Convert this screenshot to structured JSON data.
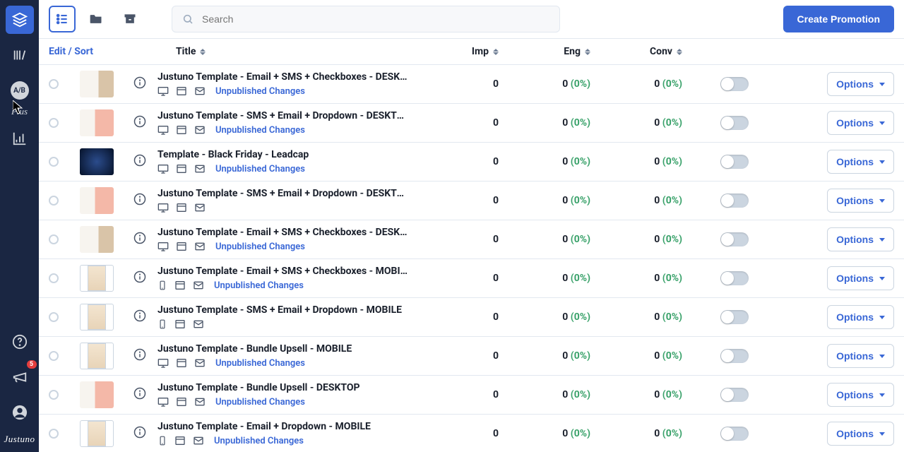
{
  "sidebar": {
    "ab_label": "A/B",
    "plus_label": "Plus",
    "brand": "Justuno",
    "notif_count": "5"
  },
  "topbar": {
    "search_placeholder": "Search",
    "create_label": "Create Promotion"
  },
  "thead": {
    "edit": "Edit / Sort",
    "title": "Title",
    "imp": "Imp",
    "eng": "Eng",
    "conv": "Conv"
  },
  "common": {
    "options": "Options",
    "unpublished": "Unpublished Changes"
  },
  "rows": [
    {
      "title": "Justuno Template - Email + SMS + Checkboxes - DESKT…",
      "imp": "0",
      "eng": "0",
      "eng_pct": "(0%)",
      "conv": "0",
      "conv_pct": "(0%)",
      "device": "desktop",
      "thumb": "person",
      "status": true
    },
    {
      "title": "Justuno Template - SMS + Email + Dropdown - DESKTO…",
      "imp": "0",
      "eng": "0",
      "eng_pct": "(0%)",
      "conv": "0",
      "conv_pct": "(0%)",
      "device": "desktop",
      "thumb": "pink",
      "status": true
    },
    {
      "title": "Template - Black Friday - Leadcap",
      "imp": "0",
      "eng": "0",
      "eng_pct": "(0%)",
      "conv": "0",
      "conv_pct": "(0%)",
      "device": "desktop",
      "thumb": "dark",
      "status": true
    },
    {
      "title": "Justuno Template - SMS + Email + Dropdown - DESKTOP",
      "imp": "0",
      "eng": "0",
      "eng_pct": "(0%)",
      "conv": "0",
      "conv_pct": "(0%)",
      "device": "desktop",
      "thumb": "pink",
      "status": false
    },
    {
      "title": "Justuno Template - Email + SMS + Checkboxes - DESKT…",
      "imp": "0",
      "eng": "0",
      "eng_pct": "(0%)",
      "conv": "0",
      "conv_pct": "(0%)",
      "device": "desktop",
      "thumb": "person",
      "status": true
    },
    {
      "title": "Justuno Template - Email + SMS + Checkboxes - MOBILE",
      "imp": "0",
      "eng": "0",
      "eng_pct": "(0%)",
      "conv": "0",
      "conv_pct": "(0%)",
      "device": "mobile",
      "thumb": "mobile",
      "status": true
    },
    {
      "title": "Justuno Template - SMS + Email + Dropdown - MOBILE",
      "imp": "0",
      "eng": "0",
      "eng_pct": "(0%)",
      "conv": "0",
      "conv_pct": "(0%)",
      "device": "mobile",
      "thumb": "mobile",
      "status": false
    },
    {
      "title": "Justuno Template - Bundle Upsell - MOBILE",
      "imp": "0",
      "eng": "0",
      "eng_pct": "(0%)",
      "conv": "0",
      "conv_pct": "(0%)",
      "device": "desktop",
      "thumb": "mobile",
      "status": true
    },
    {
      "title": "Justuno Template - Bundle Upsell - DESKTOP",
      "imp": "0",
      "eng": "0",
      "eng_pct": "(0%)",
      "conv": "0",
      "conv_pct": "(0%)",
      "device": "desktop",
      "thumb": "pink",
      "status": true
    },
    {
      "title": "Justuno Template - Email + Dropdown - MOBILE",
      "imp": "0",
      "eng": "0",
      "eng_pct": "(0%)",
      "conv": "0",
      "conv_pct": "(0%)",
      "device": "mobile",
      "thumb": "mobile",
      "status": true
    }
  ]
}
